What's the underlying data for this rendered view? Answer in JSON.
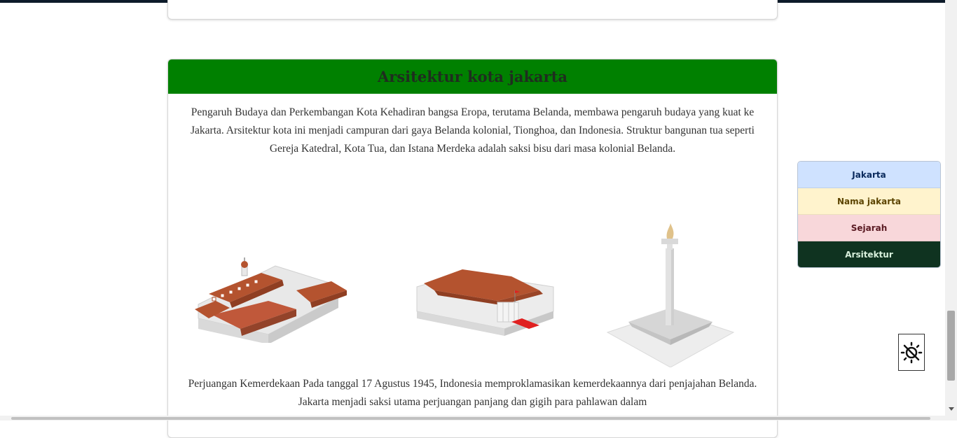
{
  "section": {
    "title": "Arsitektur kota jakarta",
    "paragraph1": "Pengaruh Budaya dan Perkembangan Kota Kehadiran bangsa Eropa, terutama Belanda, membawa pengaruh budaya yang kuat ke Jakarta. Arsitektur kota ini menjadi campuran dari gaya Belanda kolonial, Tionghoa, dan Indonesia. Struktur bangunan tua seperti Gereja Katedral, Kota Tua, dan Istana Merdeka adalah saksi bisu dari masa kolonial Belanda.",
    "paragraph2": "Perjuangan Kemerdekaan Pada tanggal 17 Agustus 1945, Indonesia memproklamasikan kemerdekaannya dari penjajahan Belanda. Jakarta menjadi saksi utama perjuangan panjang dan gigih para pahlawan dalam"
  },
  "sidenav": {
    "items": [
      {
        "label": "Jakarta"
      },
      {
        "label": "Nama jakarta"
      },
      {
        "label": "Sejarah"
      },
      {
        "label": "Arsitektur"
      }
    ]
  },
  "theme_toggle": {
    "icon": "theme-toggle-icon"
  },
  "colors": {
    "header_green": "#008000",
    "nav_active": "#0f3320"
  }
}
